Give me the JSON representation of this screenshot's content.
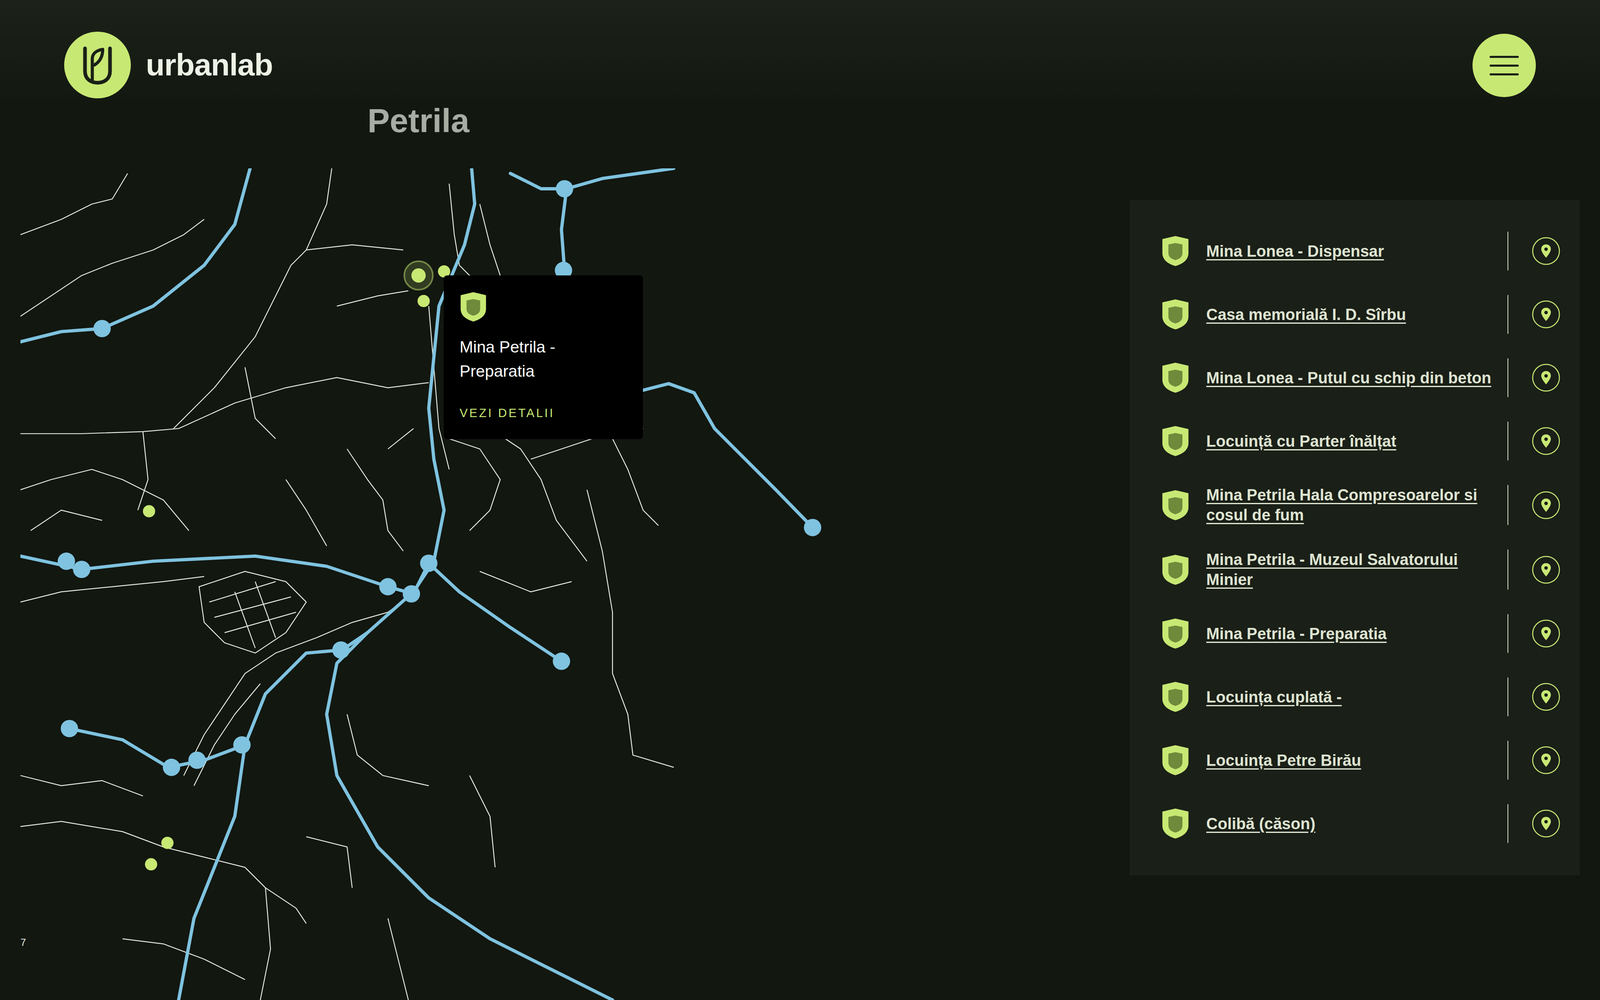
{
  "logo": {
    "text": "urbanlab"
  },
  "menu": {
    "label": "menu"
  },
  "page": {
    "title": "Petrila"
  },
  "map": {
    "attribution": "7",
    "pins": [
      {
        "active": true
      },
      {
        "active": false
      },
      {
        "active": false
      },
      {
        "active": false
      },
      {
        "active": false
      },
      {
        "active": false
      }
    ],
    "tooltip": {
      "title": "Mina Petrila - Preparatia",
      "link": "VEZI DETALII"
    }
  },
  "places": [
    {
      "name": "Mina Lonea - Dispensar"
    },
    {
      "name": "Casa memorială I. D. Sîrbu"
    },
    {
      "name": "Mina Lonea - Putul cu schip din beton"
    },
    {
      "name": "Locuință cu Parter înălțat"
    },
    {
      "name": "Mina Petrila Hala Compresoarelor si cosul de fum"
    },
    {
      "name": "Mina Petrila - Muzeul Salvatorului Minier"
    },
    {
      "name": "Mina Petrila - Preparatia"
    },
    {
      "name": "Locuința cuplată -"
    },
    {
      "name": "Locuința Petre Birău"
    },
    {
      "name": "Colibă (căson)"
    }
  ]
}
